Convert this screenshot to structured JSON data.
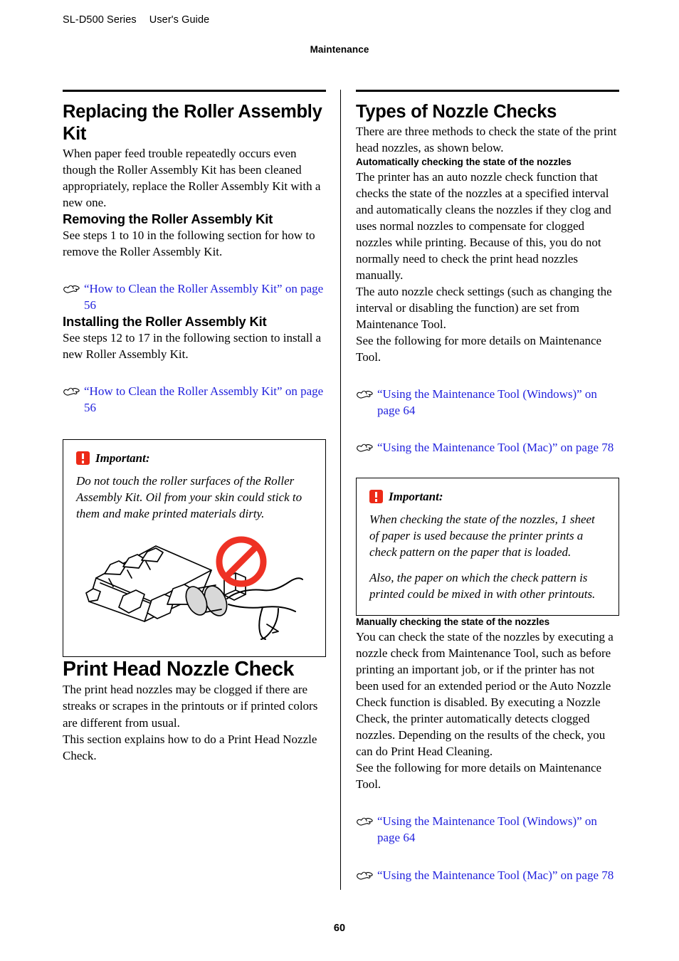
{
  "header": {
    "product": "SL-D500 Series",
    "guide": "User's Guide",
    "chapter": "Maintenance"
  },
  "footer": {
    "page_number": "60"
  },
  "colors": {
    "link": "#2222dd",
    "important_icon": "#ec2a17",
    "prohibition": "#ee3124",
    "rule": "#000000"
  },
  "icons": {
    "xref": "pointing-hand-icon",
    "important": "exclamation-icon",
    "prohibition": "no-entry-icon"
  },
  "left_column": {
    "section_title": "Replacing the Roller Assembly Kit",
    "intro": "When paper feed trouble repeatedly occurs even though the Roller Assembly Kit has been cleaned appropriately, replace the Roller Assembly Kit with a new one.",
    "removing": {
      "title": "Removing the Roller Assembly Kit",
      "body": "See steps 1 to 10 in the following section for how to remove the Roller Assembly Kit.",
      "link": "“How to Clean the Roller Assembly Kit” on page 56"
    },
    "installing": {
      "title": "Installing the Roller Assembly Kit",
      "body": "See steps 12 to 17 in the following section to install a new Roller Assembly Kit.",
      "link": "“How to Clean the Roller Assembly Kit” on page 56"
    },
    "important": {
      "label": "Important:",
      "paragraphs": [
        "Do not touch the roller surfaces of the Roller Assembly Kit. Oil from your skin could stick to them and make printed materials dirty."
      ],
      "figure_caption": "Illustration of a roller assembly being touched by a hand, marked with a red prohibition symbol"
    },
    "nozzle_check": {
      "title": "Print Head Nozzle Check",
      "paragraph_1": "The print head nozzles may be clogged if there are streaks or scrapes in the printouts or if printed colors are different from usual.",
      "paragraph_2": "This section explains how to do a Print Head Nozzle Check."
    }
  },
  "right_column": {
    "section_title": "Types of Nozzle Checks",
    "intro": "There are three methods to check the state of the print head nozzles, as shown below.",
    "automatic": {
      "title": "Automatically checking the state of the nozzles",
      "paragraph_1": "The printer has an auto nozzle check function that checks the state of the nozzles at a specified interval and automatically cleans the nozzles if they clog and uses normal nozzles to compensate for clogged nozzles while printing. Because of this, you do not normally need to check the print head nozzles manually.",
      "paragraph_2": "The auto nozzle check settings (such as changing the interval or disabling the function) are set from Maintenance Tool.",
      "paragraph_3": "See the following for more details on Maintenance Tool.",
      "link_windows": "“Using the Maintenance Tool (Windows)” on page 64",
      "link_mac": "“Using the Maintenance Tool (Mac)” on page 78"
    },
    "important": {
      "label": "Important:",
      "paragraphs": [
        "When checking the state of the nozzles, 1 sheet of paper is used because the printer prints a check pattern on the paper that is loaded.",
        "Also, the paper on which the check pattern is printed could be mixed in with other printouts."
      ]
    },
    "manual": {
      "title": "Manually checking the state of the nozzles",
      "paragraph_1": "You can check the state of the nozzles by executing a nozzle check from Maintenance Tool, such as before printing an important job, or if the printer has not been used for an extended period or the Auto Nozzle Check function is disabled. By executing a Nozzle Check, the printer automatically detects clogged nozzles. Depending on the results of the check, you can do Print Head Cleaning.",
      "paragraph_2": "See the following for more details on Maintenance Tool.",
      "link_windows": "“Using the Maintenance Tool (Windows)” on page 64",
      "link_mac": "“Using the Maintenance Tool (Mac)” on page 78"
    }
  }
}
